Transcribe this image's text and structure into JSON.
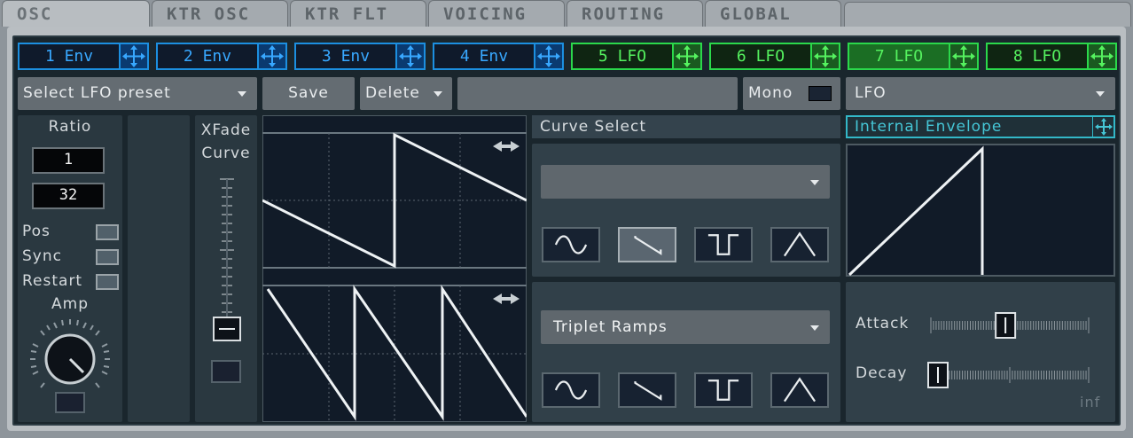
{
  "tabs": [
    "OSC",
    "KTR OSC",
    "KTR FLT",
    "VOICING",
    "ROUTING",
    "GLOBAL"
  ],
  "mod_tabs": [
    {
      "label": "1 Env",
      "kind": "env"
    },
    {
      "label": "2 Env",
      "kind": "env"
    },
    {
      "label": "3 Env",
      "kind": "env"
    },
    {
      "label": "4 Env",
      "kind": "env"
    },
    {
      "label": "5 LFO",
      "kind": "lfo"
    },
    {
      "label": "6 LFO",
      "kind": "lfo"
    },
    {
      "label": "7 LFO",
      "kind": "lfo",
      "selected": true
    },
    {
      "label": "8 LFO",
      "kind": "lfo"
    }
  ],
  "preset": {
    "select_label": "Select LFO preset",
    "save": "Save",
    "delete": "Delete",
    "name_value": ""
  },
  "mono_label": "Mono",
  "lfo_type": "LFO",
  "ratio": {
    "label": "Ratio",
    "numerator": "1",
    "denominator": "32"
  },
  "checks": {
    "pos": "Pos",
    "sync": "Sync",
    "restart": "Restart"
  },
  "amp_label": "Amp",
  "xfade_label": "XFade Curve",
  "curve_select": {
    "label": "Curve Select",
    "dropdown1_value": "",
    "dropdown2_value": "Triplet Ramps",
    "row1_selected": "ramp",
    "row2_selected": ""
  },
  "internal_env": {
    "label": "Internal Envelope",
    "attack_label": "Attack",
    "decay_label": "Decay",
    "decay_max_label": "inf",
    "attack_value": 0.47,
    "decay_value": 0.0
  },
  "colors": {
    "env_accent": "#1c8fe0",
    "lfo_accent": "#2bd84b",
    "internal_env_accent": "#33b8c8"
  }
}
